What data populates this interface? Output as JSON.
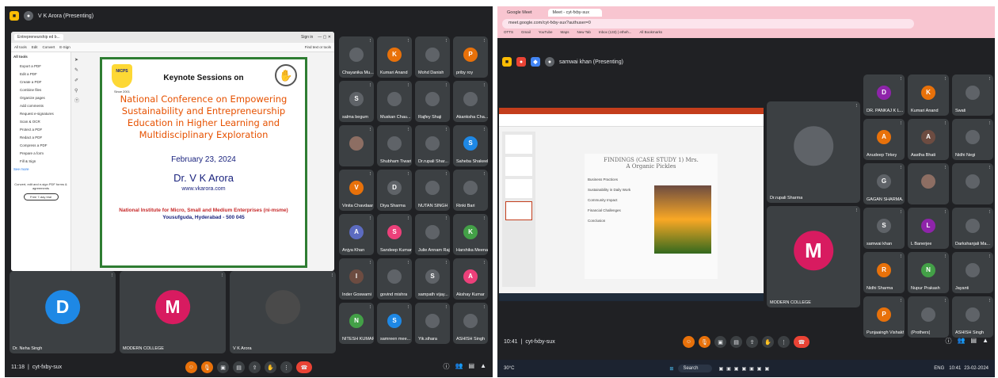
{
  "left": {
    "presenter": "V K Arora (Presenting)",
    "meeting_code": "cyt-fxby-sux",
    "time": "11:18",
    "slide": {
      "heading": "Keynote Sessions on",
      "title": "National Conference on Empowering Sustainability and Entrepreneurship Education in Higher Learning and Multidisciplinary Exploration",
      "date": "February 23, 2024",
      "speaker": "Dr. V K Arora",
      "site": "www.vkarora.com",
      "institute": "National Institute for Micro, Small and Medium Enterprises (ni-msme)",
      "address": "Yousufguda, Hyderabad - 500 045",
      "logo_text": "NICPS",
      "logo_year": "Since 2001"
    },
    "sidebar": {
      "title": "All tools",
      "items": [
        "Export a PDF",
        "Edit a PDF",
        "Create a PDF",
        "Combine files",
        "Organize pages",
        "Add comments",
        "Request e-signatures",
        "Scan & OCR",
        "Protect a PDF",
        "Redact a PDF",
        "Compress a PDF",
        "Prepare a form",
        "Fill & Sign"
      ],
      "see_more": "See more",
      "promo": "Convert, edit and e-sign PDF forms & agreements",
      "promo_btn": "Free 7-day trial"
    },
    "acro_tabs": [
      "All tools",
      "Edit",
      "Convert",
      "E-Sign"
    ],
    "acro_tab": "Entrepreneurship ed b...",
    "sign_in": "Sign in",
    "find_text": "Find text or tools",
    "participants": [
      {
        "name": "Chayanika Mu...",
        "initial": "",
        "color": "#5f6368"
      },
      {
        "name": "Kumari Anand",
        "initial": "K",
        "color": "#e8710a"
      },
      {
        "name": "Mohd Danish",
        "initial": "",
        "color": "#5f6368"
      },
      {
        "name": "priby roy",
        "initial": "P",
        "color": "#e8710a"
      },
      {
        "name": "salma begum",
        "initial": "S",
        "color": "#5f6368"
      },
      {
        "name": "Muskan Chau...",
        "initial": "",
        "color": "#5f6368"
      },
      {
        "name": "Rajfey Shaji",
        "initial": "",
        "color": "#5f6368"
      },
      {
        "name": "Akanksha Cha...",
        "initial": "",
        "color": "#5f6368"
      },
      {
        "name": "",
        "initial": "",
        "color": "#8d6e63"
      },
      {
        "name": "Shubham Tiwari",
        "initial": "",
        "color": "#5f6368"
      },
      {
        "name": "Dr.rupali Shar...",
        "initial": "",
        "color": "#5f6368"
      },
      {
        "name": "Saheba Shakeel",
        "initial": "S",
        "color": "#1e88e5"
      },
      {
        "name": "Vinita Chavdaar",
        "initial": "V",
        "color": "#e8710a"
      },
      {
        "name": "Diya Sharma",
        "initial": "D",
        "color": "#5f6368"
      },
      {
        "name": "NUTAN SINGH",
        "initial": "",
        "color": "#5f6368"
      },
      {
        "name": "Rinki Bari",
        "initial": "",
        "color": "#5f6368"
      },
      {
        "name": "Anjya Khan",
        "initial": "A",
        "color": "#5c6bc0"
      },
      {
        "name": "Sandeep Kumar",
        "initial": "S",
        "color": "#ec407a"
      },
      {
        "name": "Julie Annam Raj",
        "initial": "",
        "color": "#5f6368"
      },
      {
        "name": "Harshika Meena",
        "initial": "K",
        "color": "#43a047"
      },
      {
        "name": "Inder Goswami",
        "initial": "I",
        "color": "#6d4c41"
      },
      {
        "name": "govind mishra",
        "initial": "",
        "color": "#5f6368"
      },
      {
        "name": "sampath vijay...",
        "initial": "S",
        "color": "#5f6368"
      },
      {
        "name": "Akshay Kumar",
        "initial": "A",
        "color": "#ec407a"
      },
      {
        "name": "NITESH KUMAR",
        "initial": "N",
        "color": "#43a047"
      },
      {
        "name": "samreen mee...",
        "initial": "S",
        "color": "#1e88e5"
      },
      {
        "name": "Yik.sihara",
        "initial": "",
        "color": "#5f6368"
      },
      {
        "name": "ASHISH Singh",
        "initial": "",
        "color": "#5f6368"
      }
    ],
    "bottom_tiles": [
      {
        "name": "Dr. Neha Singh",
        "initial": "D",
        "color": "#1e88e5"
      },
      {
        "name": "MODERN COLLEGE",
        "initial": "M",
        "color": "#d81b60"
      },
      {
        "name": "V K Arora",
        "initial": "",
        "color": "#4a4a4a"
      }
    ]
  },
  "right": {
    "browser_tabs": [
      "Google Meet",
      "Meet - cyt-fxby-sux"
    ],
    "url": "meet.google.com/cyt-fxby-sux?authuser=0",
    "bookmarks": [
      "OTTS",
      "Gmail",
      "YouTube",
      "Maps",
      "New Tab",
      "Inbox (133) | etheh...",
      "All Bookmarks"
    ],
    "presenter": "samwai khan (Presenting)",
    "meeting_code": "cyt-fxby-sux",
    "time": "10:41",
    "slide": {
      "title": "FINDINGS (CASE STUDY 1) Mrs. A Organic Pickles",
      "bullets": [
        "Business Practices",
        "Sustainability in Daily Work",
        "Community Impact",
        "Financial Challenges",
        "Conclusion"
      ]
    },
    "big_tiles": [
      {
        "name": "Dr.rupali Sharma",
        "initial": "",
        "color": "#5f6368"
      },
      {
        "name": "MODERN COLLEGE",
        "initial": "M",
        "color": "#d81b60"
      }
    ],
    "participants": [
      {
        "name": "DR. PANKAJ K L...",
        "initial": "D",
        "color": "#8e24aa"
      },
      {
        "name": "Kumari Anand",
        "initial": "K",
        "color": "#e8710a"
      },
      {
        "name": "Swati",
        "initial": "",
        "color": "#5f6368"
      },
      {
        "name": "Anudeep Tirkey",
        "initial": "A",
        "color": "#e8710a"
      },
      {
        "name": "Aastha Bhati",
        "initial": "A",
        "color": "#6d4c41"
      },
      {
        "name": "Nidhi Negi",
        "initial": "",
        "color": "#5f6368"
      },
      {
        "name": "GAGAN SHARMA...",
        "initial": "G",
        "color": "#5f6368"
      },
      {
        "name": "",
        "initial": "",
        "color": "#8d6e63"
      },
      {
        "name": "",
        "initial": "",
        "color": "#5f6368"
      },
      {
        "name": "samwai khan",
        "initial": "S",
        "color": "#5f6368"
      },
      {
        "name": "L Banerjee",
        "initial": "L",
        "color": "#8e24aa"
      },
      {
        "name": "Darkshanjali Ma...",
        "initial": "",
        "color": "#5f6368"
      },
      {
        "name": "Nidhi Sharma",
        "initial": "R",
        "color": "#e8710a"
      },
      {
        "name": "Nupur Prakash",
        "initial": "N",
        "color": "#43a047"
      },
      {
        "name": "Jayanti",
        "initial": "",
        "color": "#5f6368"
      },
      {
        "name": "Punjaaingh Vishakh",
        "initial": "P",
        "color": "#e8710a"
      },
      {
        "name": "(Prothers)",
        "initial": "",
        "color": "#5f6368"
      },
      {
        "name": "ASHISH Singh",
        "initial": "",
        "color": "#5f6368"
      }
    ],
    "taskbar": {
      "search": "Search",
      "weather": "30°C",
      "time": "10:41",
      "date": "23-02-2024",
      "lang": "ENG"
    }
  },
  "colors": {
    "meet_bg": "#202124",
    "tile": "#3c4043",
    "end_call": "#ea4335",
    "slide_border": "#2e7d32"
  }
}
